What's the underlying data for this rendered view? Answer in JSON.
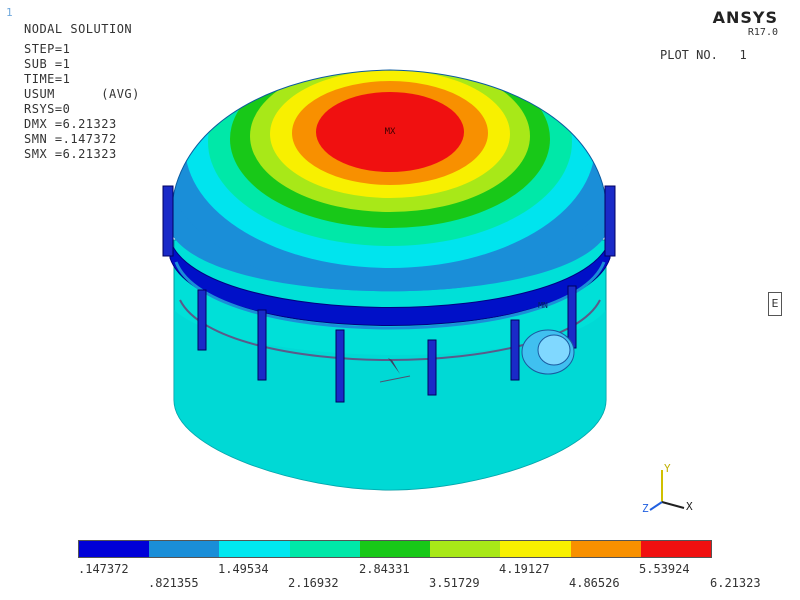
{
  "window_number": "1",
  "info_lines": [
    "NODAL SOLUTION",
    "STEP=1",
    "SUB =1",
    "TIME=1",
    "USUM      (AVG)",
    "RSYS=0",
    "DMX =6.21323",
    "SMN =.147372",
    "SMX =6.21323"
  ],
  "brand": {
    "name": "ANSYS",
    "version": "R17.0"
  },
  "plot_number": "PLOT NO.   1",
  "marker_mx": "MX",
  "marker_mn": "MN",
  "edge_tag": "E",
  "triad": {
    "x": "X",
    "y": "Y",
    "z": "Z"
  },
  "legend": {
    "labels": [
      ".147372",
      ".821355",
      "1.49534",
      "2.16932",
      "2.84331",
      "3.51729",
      "4.19127",
      "4.86526",
      "5.53924",
      "6.21323"
    ],
    "colors": [
      "#0000d8",
      "#1a8ed8",
      "#00e8f0",
      "#00e8a8",
      "#18c818",
      "#a8e818",
      "#f8f000",
      "#f89000",
      "#f01010"
    ]
  },
  "palette": {
    "cylinder": "#00e8e0",
    "dome_base": "#1a8ed8",
    "ring": "#0000c8"
  }
}
